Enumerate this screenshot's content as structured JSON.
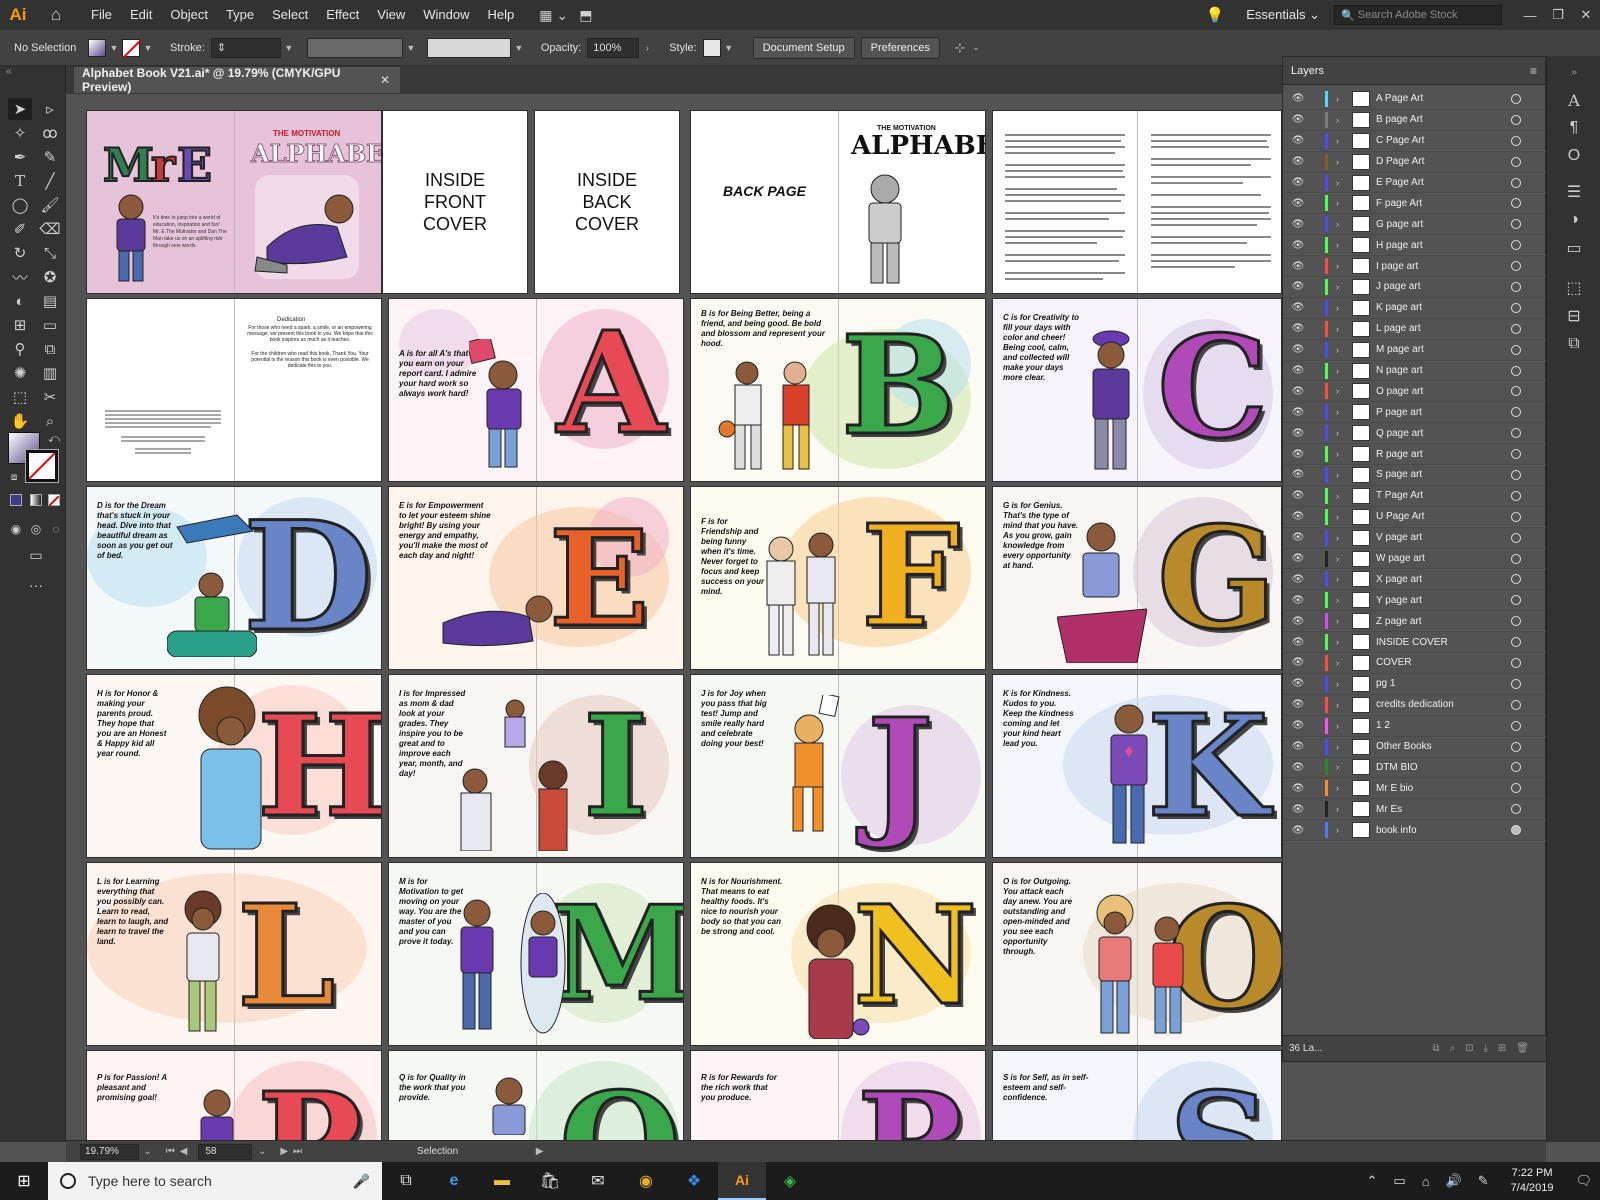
{
  "app": {
    "logo": "Ai",
    "home_icon": "home-icon"
  },
  "menu": [
    "File",
    "Edit",
    "Object",
    "Type",
    "Select",
    "Effect",
    "View",
    "Window",
    "Help"
  ],
  "workspace": "Essentials",
  "stock_search_placeholder": "Search Adobe Stock",
  "window_controls": [
    "—",
    "❐",
    "✕"
  ],
  "control": {
    "selection_label": "No Selection",
    "stroke_label": "Stroke:",
    "opacity_label": "Opacity:",
    "opacity_value": "100%",
    "style_label": "Style:",
    "document_setup": "Document Setup",
    "preferences": "Preferences"
  },
  "document_tab": {
    "title": "Alphabet Book V21.ai* @ 19.79% (CMYK/GPU Preview)",
    "close": "✕"
  },
  "artboards": {
    "inside_front_cover": "INSIDE FRONT COVER",
    "inside_back_cover": "INSIDE BACK COVER",
    "back_page": "BACK PAGE",
    "cover_title_small": "THE MOTIVATION",
    "cover_title": "ALPHABET",
    "dedication_title": "Dedication",
    "dedication_body": "For those who need a spark, a smile, or an empowering message, we present this book to you. We hope that this book inspires as much as it teaches.",
    "dedication_children": "For the children who read this book, Thank You. Your potential is the reason this book is even possible. We dedicate this to you.",
    "pages": [
      {
        "letter": "A",
        "text": "A is for all A's that you earn on your report card. I admire your hard work so always work hard!"
      },
      {
        "letter": "B",
        "text": "B is for Being Better, being a friend, and being good. Be bold and blossom and represent your hood."
      },
      {
        "letter": "C",
        "text": "C is for Creativity to fill your days with color and cheer! Being cool, calm, and collected will make your days more clear."
      },
      {
        "letter": "D",
        "text": "D is for the Dream that's stuck in your head. Dive into that beautiful dream as soon as you get out of bed."
      },
      {
        "letter": "E",
        "text": "E is for Empowerment to let your esteem shine bright! By using your energy and empathy, you'll make the most of each day and night!"
      },
      {
        "letter": "F",
        "text": "F is for Friendship and being funny when it's time. Never forget to focus and keep success on your mind."
      },
      {
        "letter": "G",
        "text": "G is for Genius. That's the type of mind that you have. As you grow, gain knowledge from every opportunity at hand."
      },
      {
        "letter": "H",
        "text": "H is for Honor & making your parents proud. They hope that you are an Honest & Happy kid all year round."
      },
      {
        "letter": "I",
        "text": "I is for Impressed as mom & dad look at your grades. They inspire you to be great and to improve each year, month, and day!"
      },
      {
        "letter": "J",
        "text": "J is for Joy when you pass that big test! Jump and smile really hard and celebrate doing your best!"
      },
      {
        "letter": "K",
        "text": "K is for Kindness. Kudos to you. Keep the kindness coming and let your kind heart lead you."
      },
      {
        "letter": "L",
        "text": "L is for Learning everything that you possibly can. Learn to read, learn to laugh, and learn to travel the land."
      },
      {
        "letter": "M",
        "text": "M is for Motivation to get moving on your way. You are the master of you and you can prove it today."
      },
      {
        "letter": "N",
        "text": "N is for Nourishment. That means to eat healthy foods. It's nice to nourish your body so that you can be strong and cool."
      },
      {
        "letter": "O",
        "text": "O is for Outgoing. You attack each day anew. You are outstanding and open-minded and you see each opportunity through."
      },
      {
        "letter": "P",
        "text": "P is for Passion! A pleasant and promising goal!"
      },
      {
        "letter": "Q",
        "text": "Q is for Quality in the work that you provide."
      },
      {
        "letter": "R",
        "text": "R is for Rewards for the rich work that you produce."
      },
      {
        "letter": "S",
        "text": "S is for Self, as in self-esteem and self-confidence."
      }
    ]
  },
  "layers_panel": {
    "title": "Layers",
    "count": "36 La...",
    "layers": [
      {
        "name": "A Page Art",
        "color": "#4fd7ff"
      },
      {
        "name": "B page Art",
        "color": "#7a7a7a"
      },
      {
        "name": "C Page Art",
        "color": "#4a4aff"
      },
      {
        "name": "D Page Art",
        "color": "#8a5a2a"
      },
      {
        "name": "E Page Art",
        "color": "#4a4aff"
      },
      {
        "name": "F page Art",
        "color": "#4aff4a"
      },
      {
        "name": "G page art",
        "color": "#4a4aff"
      },
      {
        "name": "H page art",
        "color": "#4aff4a"
      },
      {
        "name": "I page art",
        "color": "#ff4a4a"
      },
      {
        "name": "J page art",
        "color": "#4aff4a"
      },
      {
        "name": "K page art",
        "color": "#4a4aff"
      },
      {
        "name": "L page art",
        "color": "#ff4a4a"
      },
      {
        "name": "M page art",
        "color": "#4a4aff"
      },
      {
        "name": "N page art",
        "color": "#4aff4a"
      },
      {
        "name": "O page art",
        "color": "#ff4a4a"
      },
      {
        "name": "P page art",
        "color": "#4a4aff"
      },
      {
        "name": "Q page art",
        "color": "#4a4aff"
      },
      {
        "name": "R page art",
        "color": "#4aff4a"
      },
      {
        "name": "S page art",
        "color": "#4a4aff"
      },
      {
        "name": "T Page Art",
        "color": "#4aff4a"
      },
      {
        "name": "U Page Art",
        "color": "#4aff4a"
      },
      {
        "name": "V page art",
        "color": "#4a4aff"
      },
      {
        "name": "W page art",
        "color": "#222222"
      },
      {
        "name": "X page art",
        "color": "#4a4aff"
      },
      {
        "name": "Y page art",
        "color": "#4aff4a"
      },
      {
        "name": "Z page art",
        "color": "#d44aff"
      },
      {
        "name": "INSIDE COVER",
        "color": "#4aff4a"
      },
      {
        "name": "COVER",
        "color": "#ff4a4a"
      },
      {
        "name": "pg 1",
        "color": "#4a4aff"
      },
      {
        "name": "credits dedication",
        "color": "#ff4a4a"
      },
      {
        "name": "1 2",
        "color": "#ff4aff"
      },
      {
        "name": "Other Books",
        "color": "#4a4aff"
      },
      {
        "name": "DTM BIO",
        "color": "#2a8a2a"
      },
      {
        "name": "Mr E bio",
        "color": "#ff8a2a"
      },
      {
        "name": "Mr Es",
        "color": "#222222"
      },
      {
        "name": "book info",
        "color": "#4a7aff"
      }
    ]
  },
  "status": {
    "zoom": "19.79%",
    "page": "58",
    "mode": "Selection"
  },
  "taskbar": {
    "search_placeholder": "Type here to search",
    "time": "7:22 PM",
    "date": "7/4/2019"
  }
}
